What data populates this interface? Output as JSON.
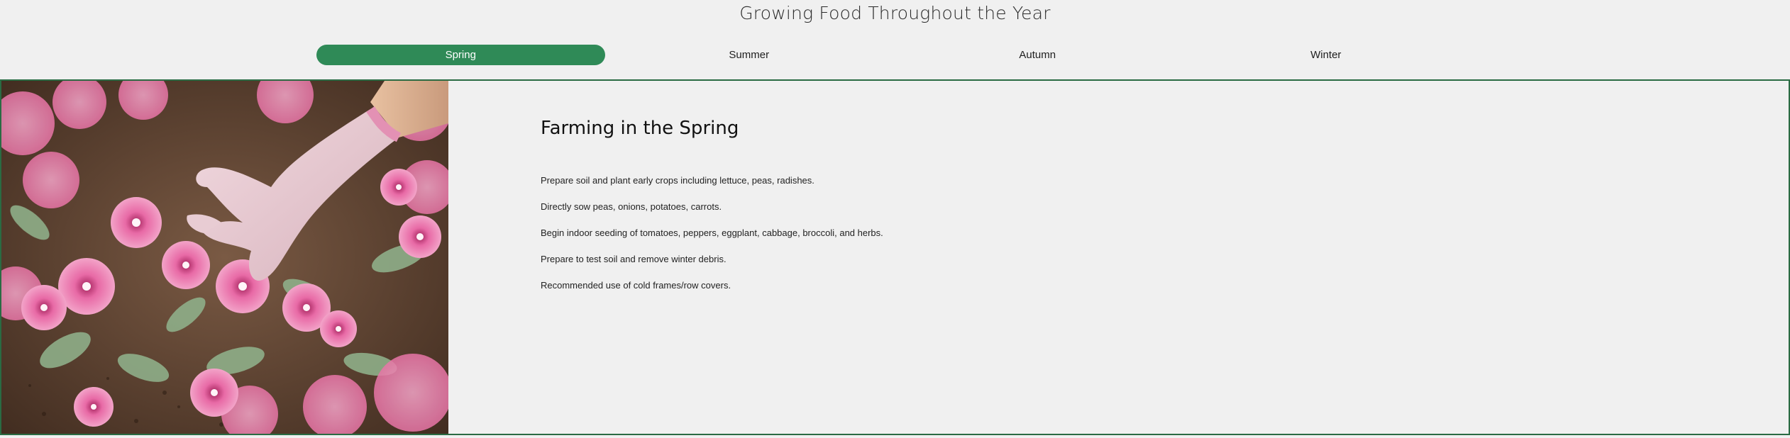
{
  "header": {
    "title": "Growing Food Throughout the Year"
  },
  "tabs": [
    {
      "label": "Spring",
      "active": true
    },
    {
      "label": "Summer",
      "active": false
    },
    {
      "label": "Autumn",
      "active": false
    },
    {
      "label": "Winter",
      "active": false
    }
  ],
  "panel": {
    "heading": "Farming in the Spring",
    "items": [
      "Prepare soil and plant early crops including lettuce, peas, radishes.",
      "Directly sow peas, onions, potatoes, carrots.",
      "Begin indoor seeding of tomatoes, peppers, eggplant, cabbage, broccoli, and herbs.",
      "Prepare to test soil and remove winter debris.",
      "Recommended use of cold frames/row covers."
    ]
  },
  "colors": {
    "accent": "#2f8a57",
    "panel_border": "#2a6b43",
    "background": "#f0f0f0"
  }
}
